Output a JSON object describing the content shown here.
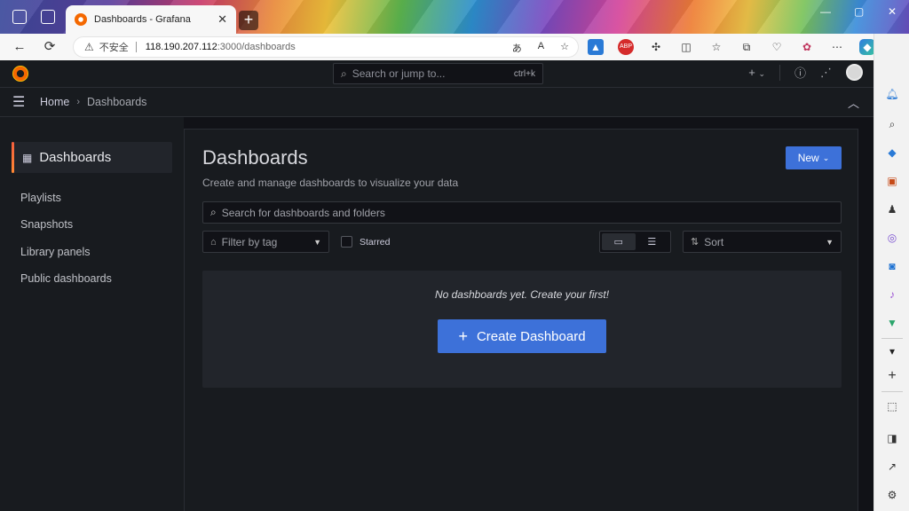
{
  "browser": {
    "tab_title": "Dashboards - Grafana",
    "tab_close": "✕",
    "new_tab": "+",
    "url_warning": "不安全",
    "url_host": "118.190.207.112",
    "url_path": ":3000/dashboards",
    "window_controls": [
      "—",
      "▢",
      "✕"
    ]
  },
  "grafana": {
    "search_placeholder": "Search or jump to...",
    "search_shortcut": "ctrl+k",
    "add_label": "+",
    "breadcrumb": {
      "home": "Home",
      "separator": "›",
      "current": "Dashboards"
    },
    "sidebar": {
      "section_title": "Dashboards",
      "items": [
        {
          "label": "Playlists"
        },
        {
          "label": "Snapshots"
        },
        {
          "label": "Library panels"
        },
        {
          "label": "Public dashboards"
        }
      ]
    },
    "page": {
      "title": "Dashboards",
      "subtitle": "Create and manage dashboards to visualize your data",
      "new_button": "New",
      "search_placeholder": "Search for dashboards and folders",
      "filter_by_tag": "Filter by tag",
      "starred_label": "Starred",
      "sort_label": "Sort",
      "empty_message": "No dashboards yet. Create your first!",
      "create_button": "Create Dashboard"
    }
  },
  "colors": {
    "primary_button": "#3d71d9",
    "background": "#111217",
    "panel": "#181b1f",
    "accent": "#f46800"
  }
}
